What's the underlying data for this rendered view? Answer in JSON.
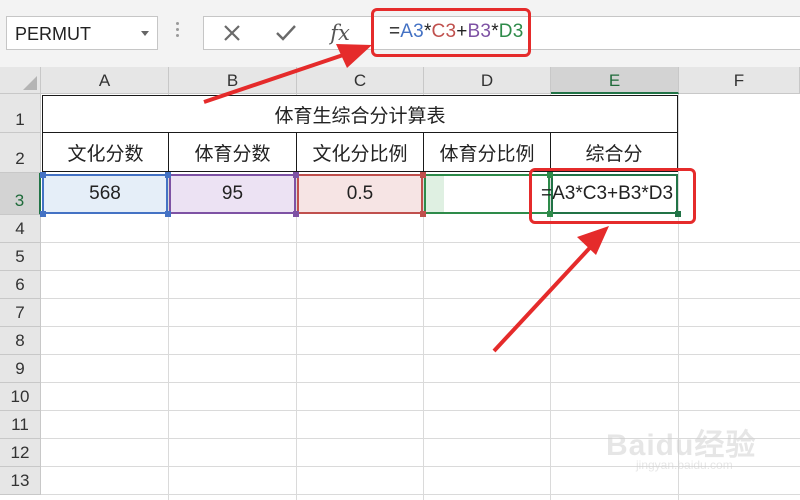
{
  "name_box": {
    "value": "PERMUT"
  },
  "formula_bar": {
    "cancel_icon": "close-icon",
    "enter_icon": "check-icon",
    "function_label": "fx",
    "formula_parts": [
      {
        "text": "=",
        "color": "#222222"
      },
      {
        "text": "A3",
        "color": "#4472c4"
      },
      {
        "text": "*",
        "color": "#222222"
      },
      {
        "text": "C3",
        "color": "#c0504d"
      },
      {
        "text": "+",
        "color": "#222222"
      },
      {
        "text": "B3",
        "color": "#7e52a4"
      },
      {
        "text": "*",
        "color": "#222222"
      },
      {
        "text": "D3",
        "color": "#2e8b4a"
      }
    ]
  },
  "columns": [
    "A",
    "B",
    "C",
    "D",
    "E",
    "F"
  ],
  "rows": [
    "1",
    "2",
    "3",
    "4",
    "5",
    "6",
    "7",
    "8",
    "9",
    "10",
    "11",
    "12",
    "13"
  ],
  "selected_column": "E",
  "selected_row": "3",
  "sheet": {
    "title": "体育生综合分计算表",
    "headers": [
      "文化分数",
      "体育分数",
      "文化分比例",
      "体育分比例",
      "综合分"
    ],
    "row3": {
      "a": "568",
      "b": "95",
      "c": "0.5",
      "d": "",
      "e_formula": "=A3*C3+B3*D3"
    }
  },
  "colors": {
    "selection_green": "#217346",
    "annotation_red": "#e52b2b",
    "ref_a3": "#4472c4",
    "ref_b3": "#7e52a4",
    "ref_c3": "#c0504d",
    "ref_d3": "#2e8b4a"
  },
  "watermark": {
    "brand": "Baidu经验",
    "url": "jingyan.baidu.com"
  }
}
